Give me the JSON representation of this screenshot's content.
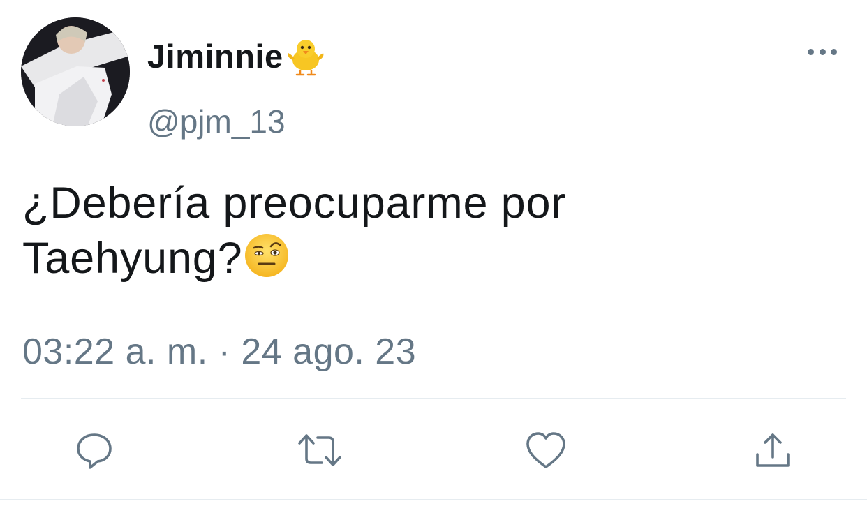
{
  "user": {
    "display_name": "Jiminnie",
    "handle": "@pjm_13",
    "name_emoji_icon": "baby-chick-icon",
    "avatar": "avatar-photo"
  },
  "tweet": {
    "text_line_1": "¿Debería preocuparme por",
    "text_line_2": "Taehyung?",
    "text_emoji_icon": "face-with-raised-eyebrow-icon",
    "timestamp": "03:22 a. m. · 24 ago. 23"
  },
  "actions": [
    {
      "name": "reply",
      "icon": "reply-icon"
    },
    {
      "name": "retweet",
      "icon": "retweet-icon"
    },
    {
      "name": "like",
      "icon": "heart-icon"
    },
    {
      "name": "share",
      "icon": "share-icon"
    }
  ],
  "header": {
    "more_icon": "more-options-icon"
  },
  "colors": {
    "text_primary": "#14171a",
    "text_secondary": "#657786",
    "divider": "#e6ecf0",
    "background": "#ffffff"
  }
}
